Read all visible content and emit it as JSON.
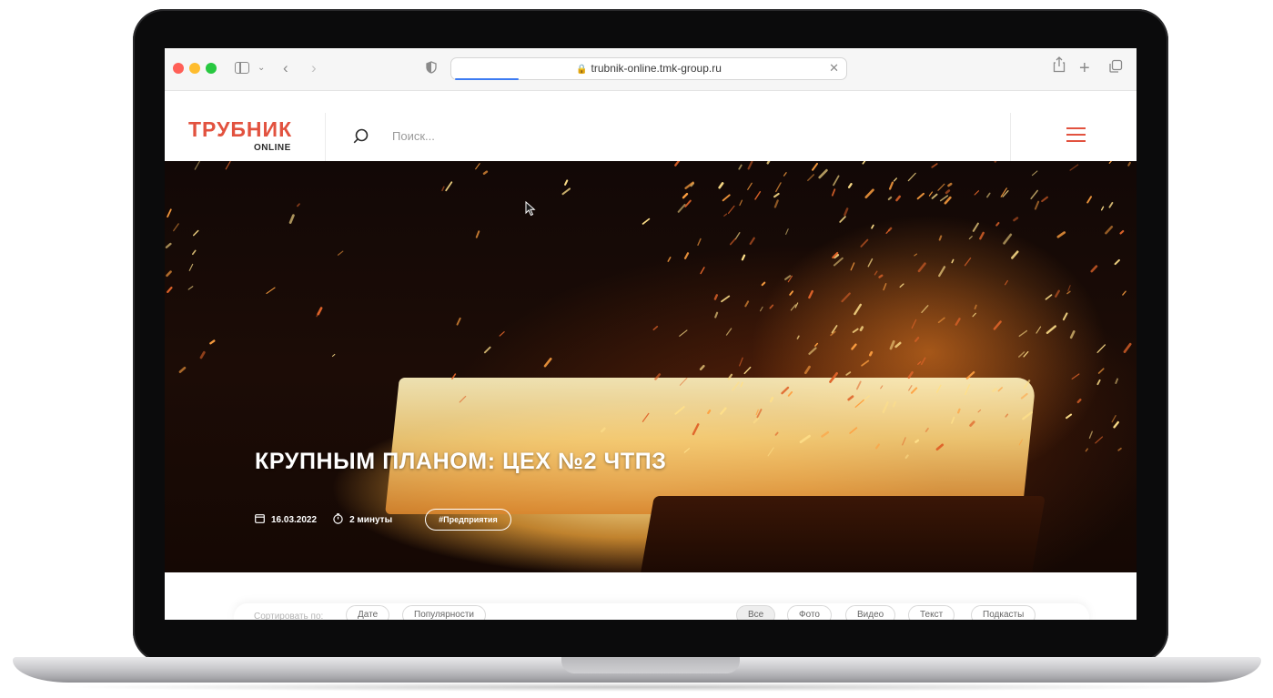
{
  "browser": {
    "url": "trubnik-online.tmk-group.ru",
    "icons": [
      "sidebar-icon",
      "chevron-down-icon",
      "back-icon",
      "forward-icon",
      "shield-icon",
      "lock-icon",
      "close-icon",
      "share-icon",
      "new-tab-icon",
      "tabs-overview-icon"
    ]
  },
  "site": {
    "logo_main": "ТРУБНИК",
    "logo_sub": "ONLINE",
    "search_placeholder": "Поиск...",
    "brand_color": "#e2523f"
  },
  "hero": {
    "title": "КРУПНЫМ ПЛАНОМ: ЦЕХ №2 ЧТПЗ",
    "date": "16.03.2022",
    "read_time": "2 минуты",
    "tag": "#Предприятия"
  },
  "filters": {
    "sort_label": "Сортировать по:",
    "sort_options": [
      "Дате",
      "Популярности"
    ],
    "type_options": [
      "Все",
      "Фото",
      "Видео",
      "Текст",
      "Подкасты"
    ]
  }
}
